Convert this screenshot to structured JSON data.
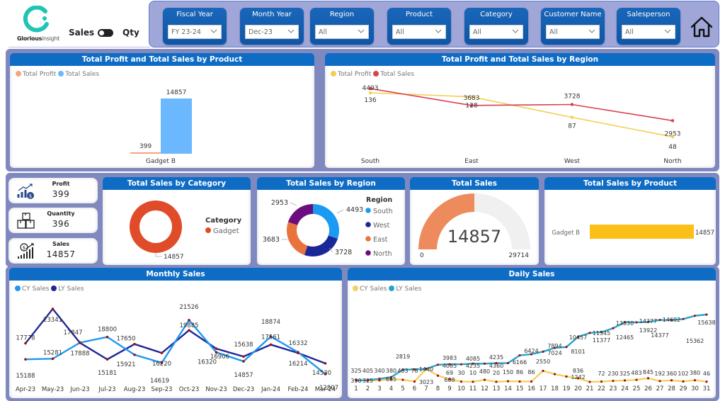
{
  "header": {
    "brand": {
      "name_bold": "Glorious",
      "name_light": "insight"
    },
    "toggle": {
      "left_label": "Sales",
      "right_label": "Qty"
    },
    "home_icon": "home-icon"
  },
  "filters": [
    {
      "title": "Fiscal Year",
      "value": "FY 23-24"
    },
    {
      "title": "Month Year",
      "value": "Dec-23"
    },
    {
      "title": "Region",
      "value": "All"
    },
    {
      "title": "Product",
      "value": "All"
    },
    {
      "title": "Category",
      "value": "All"
    },
    {
      "title": "Customer Name",
      "value": "All"
    },
    {
      "title": "Salesperson",
      "value": "All"
    }
  ],
  "kpis": [
    {
      "label": "Profit",
      "value": "399",
      "icon": "profit-chart-icon"
    },
    {
      "label": "Quantity",
      "value": "396",
      "icon": "boxes-icon"
    },
    {
      "label": "Sales",
      "value": "14857",
      "icon": "sales-growth-icon"
    }
  ],
  "colors": {
    "profit_orange": "#f4a582",
    "sales_lightblue": "#6bb8ff",
    "region_profit_yellow": "#f0cf5a",
    "region_sales_red": "#d9414d",
    "category_red": "#e04b2a",
    "south": "#1a9af0",
    "west": "#1a2799",
    "east": "#e8733c",
    "north": "#6b0d7e",
    "gauge_fill": "#ee8b5c",
    "gauge_bg": "#f0f0f0",
    "bar_gold": "#fbbf17",
    "cy_monthly": "#1e98f0",
    "ly_monthly": "#1f2796",
    "cy_daily": "#f2d160",
    "ly_daily": "#2aa3c8",
    "marker": "#a01010"
  },
  "chart_data": [
    {
      "id": "profit_sales_by_product",
      "type": "bar",
      "title": "Total Profit and Total Sales by Product",
      "legend": [
        "Total Profit",
        "Total Sales"
      ],
      "legend_position": "top-left",
      "categories": [
        "Gadget B"
      ],
      "series": [
        {
          "name": "Total Profit",
          "values": [
            399
          ]
        },
        {
          "name": "Total Sales",
          "values": [
            14857
          ]
        }
      ],
      "ylim": [
        0,
        14857
      ]
    },
    {
      "id": "profit_sales_by_region",
      "type": "line",
      "title": "Total Profit and Total Sales by Region",
      "legend": [
        "Total Profit",
        "Total Sales"
      ],
      "legend_position": "top-left",
      "categories": [
        "South",
        "East",
        "West",
        "North"
      ],
      "series": [
        {
          "name": "Total Profit",
          "values": [
            136,
            128,
            87,
            48
          ]
        },
        {
          "name": "Total Sales",
          "values": [
            4493,
            3683,
            3728,
            2953
          ]
        }
      ]
    },
    {
      "id": "sales_by_category",
      "type": "pie",
      "donut": true,
      "title": "Total Sales by Category",
      "legend_title": "Category",
      "legend_position": "right",
      "labels": [
        "Gadget"
      ],
      "values": [
        14857
      ]
    },
    {
      "id": "sales_by_region",
      "type": "pie",
      "donut": true,
      "title": "Total Sales by Region",
      "legend_title": "Region",
      "legend_position": "right",
      "labels": [
        "South",
        "West",
        "East",
        "North"
      ],
      "values": [
        4493,
        3728,
        3683,
        2953
      ]
    },
    {
      "id": "total_sales_gauge",
      "type": "gauge",
      "title": "Total Sales",
      "value": 14857,
      "min": 0,
      "max": 29714,
      "min_label": "0",
      "max_label": "29714",
      "value_label": "14857"
    },
    {
      "id": "sales_by_product",
      "type": "bar",
      "orientation": "horizontal",
      "title": "Total Sales by Product",
      "categories": [
        "Gadget B"
      ],
      "values": [
        14857
      ],
      "xlim": [
        0,
        14857
      ]
    },
    {
      "id": "monthly_sales",
      "type": "line",
      "title": "Monthly Sales",
      "legend": [
        "CY Sales",
        "LY Sales"
      ],
      "legend_position": "top-left",
      "categories": [
        "Apr-23",
        "May-23",
        "Jun-23",
        "Jul-23",
        "Aug-23",
        "Sep-23",
        "Oct-23",
        "Nov-23",
        "Dec-23",
        "Jan-24",
        "Feb-24",
        "Mar-24"
      ],
      "series": [
        {
          "name": "CY Sales",
          "values": [
            15188,
            15281,
            17888,
            18800,
            15921,
            14619,
            21526,
            16320,
            14857,
            18874,
            16332,
            12807
          ]
        },
        {
          "name": "LY Sales",
          "values": [
            17778,
            23341,
            17847,
            15181,
            17650,
            16220,
            19885,
            16906,
            15638,
            17561,
            16214,
            14530
          ]
        }
      ],
      "ylim": [
        11000,
        25000
      ]
    },
    {
      "id": "daily_sales",
      "type": "line",
      "title": "Daily Sales",
      "legend": [
        "CY Sales",
        "LY Sales"
      ],
      "legend_position": "top-left",
      "categories": [
        "1",
        "2",
        "3",
        "4",
        "5",
        "6",
        "7",
        "8",
        "9",
        "10",
        "11",
        "12",
        "13",
        "14",
        "15",
        "16",
        "17",
        "18",
        "19",
        "20",
        "21",
        "22",
        "23",
        "24",
        "25",
        "26",
        "27",
        "28",
        "29",
        "30",
        "31"
      ],
      "series": [
        {
          "name": "CY Sales",
          "values": [
            390,
            325,
            340,
            665,
            483,
            78,
            3023,
            1440,
            608,
            69,
            30,
            480,
            20,
            150,
            86,
            86,
            2550,
            1800,
            1242,
            836,
            0,
            72,
            230,
            325,
            483,
            845,
            192,
            360,
            102,
            380,
            46
          ]
        },
        {
          "name": "LY Sales",
          "values": [
            325,
            405,
            715,
            1095,
            2819,
            2897,
            3023,
            3983,
            4085,
            4085,
            4235,
            4235,
            4360,
            4360,
            6166,
            6424,
            7024,
            7894,
            8101,
            10457,
            11377,
            11545,
            12465,
            13830,
            13830,
            13922,
            14377,
            14377,
            14602,
            15362,
            15638
          ]
        }
      ],
      "data_labels": [
        {
          "day": 1,
          "text": "325"
        },
        {
          "day": 2,
          "text": "405"
        },
        {
          "day": 3,
          "text": "340"
        },
        {
          "day": 4,
          "text": "380"
        },
        {
          "day": 5,
          "text": "483"
        },
        {
          "day": 6,
          "text": "78"
        },
        {
          "day": 1,
          "text": "390"
        },
        {
          "day": 2,
          "text": "325"
        },
        {
          "day": 4,
          "text": "665"
        },
        {
          "day": 5,
          "text": "2819"
        },
        {
          "day": 7,
          "text": "1440"
        },
        {
          "day": 7,
          "text": "3023"
        },
        {
          "day": 9,
          "text": "3983"
        },
        {
          "day": 9,
          "text": "4085"
        },
        {
          "day": 9,
          "text": "69"
        },
        {
          "day": 9,
          "text": "608"
        },
        {
          "day": 10,
          "text": "30"
        },
        {
          "day": 11,
          "text": "4085"
        },
        {
          "day": 11,
          "text": "4235"
        },
        {
          "day": 11,
          "text": "10"
        },
        {
          "day": 12,
          "text": "480"
        },
        {
          "day": 13,
          "text": "4235"
        },
        {
          "day": 13,
          "text": "4360"
        },
        {
          "day": 13,
          "text": "20"
        },
        {
          "day": 14,
          "text": "150"
        },
        {
          "day": 15,
          "text": "6166"
        },
        {
          "day": 15,
          "text": "86"
        },
        {
          "day": 16,
          "text": "86"
        },
        {
          "day": 16,
          "text": "6424"
        },
        {
          "day": 17,
          "text": "2550"
        },
        {
          "day": 18,
          "text": "7894"
        },
        {
          "day": 18,
          "text": "7024"
        },
        {
          "day": 20,
          "text": "8101"
        },
        {
          "day": 20,
          "text": "10457"
        },
        {
          "day": 20,
          "text": "836"
        },
        {
          "day": 20,
          "text": "1242"
        },
        {
          "day": 22,
          "text": "11545"
        },
        {
          "day": 22,
          "text": "11377"
        },
        {
          "day": 22,
          "text": "72"
        },
        {
          "day": 23,
          "text": "230"
        },
        {
          "day": 24,
          "text": "325"
        },
        {
          "day": 24,
          "text": "13830"
        },
        {
          "day": 24,
          "text": "12465"
        },
        {
          "day": 25,
          "text": "483"
        },
        {
          "day": 26,
          "text": "845"
        },
        {
          "day": 26,
          "text": "14377"
        },
        {
          "day": 26,
          "text": "13922"
        },
        {
          "day": 27,
          "text": "192"
        },
        {
          "day": 27,
          "text": "14377"
        },
        {
          "day": 28,
          "text": "360"
        },
        {
          "day": 28,
          "text": "14602"
        },
        {
          "day": 29,
          "text": "102"
        },
        {
          "day": 30,
          "text": "380"
        },
        {
          "day": 30,
          "text": "15362"
        },
        {
          "day": 31,
          "text": "46"
        },
        {
          "day": 31,
          "text": "15638"
        }
      ]
    }
  ]
}
